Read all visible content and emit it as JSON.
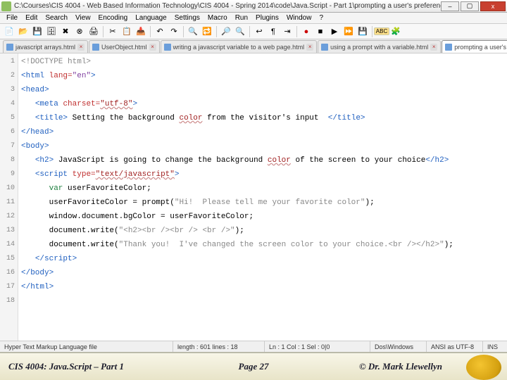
{
  "window": {
    "title": "C:\\Courses\\CIS 4004 - Web Based Information Technology\\CIS 4004 - Spring 2014\\code\\Java.Script - Part 1\\prompting a user's preference wi..."
  },
  "menu": [
    "File",
    "Edit",
    "Search",
    "View",
    "Encoding",
    "Language",
    "Settings",
    "Macro",
    "Run",
    "Plugins",
    "Window",
    "?"
  ],
  "tabs": [
    {
      "label": "javascript arrays.html",
      "active": false
    },
    {
      "label": "UserObject.html",
      "active": false
    },
    {
      "label": "writing a javascript variable to a web page.html",
      "active": false
    },
    {
      "label": "using a prompt with a variable.html",
      "active": false
    },
    {
      "label": "prompting a user's preference with a variable.htm",
      "active": true
    }
  ],
  "code": {
    "lines": [
      {
        "n": 1,
        "html": "<span class='c-gray'>&lt;!DOCTYPE html&gt;</span>"
      },
      {
        "n": 2,
        "html": "<span class='c-blue'>&lt;html</span> <span class='c-red'>lang=</span><span class='c-purple'>\"en\"</span><span class='c-blue'>&gt;</span>"
      },
      {
        "n": 3,
        "html": "<span class='c-blue'>&lt;head&gt;</span>"
      },
      {
        "n": 4,
        "html": "   <span class='c-blue'>&lt;meta</span> <span class='c-red'>charset=</span><span class='c-dred'>\"utf-8\"</span><span class='c-blue'>&gt;</span>"
      },
      {
        "n": 5,
        "html": "   <span class='c-blue'>&lt;title&gt;</span> Setting the background <span class='c-dred'>color</span> from the visitor's input  <span class='c-blue'>&lt;/title&gt;</span>"
      },
      {
        "n": 6,
        "html": "<span class='c-blue'>&lt;/head&gt;</span>"
      },
      {
        "n": 7,
        "html": "<span class='c-blue'>&lt;body&gt;</span>"
      },
      {
        "n": 8,
        "html": "   <span class='c-blue'>&lt;h2&gt;</span> JavaScript is going to change the background <span class='c-dred'>color</span> of the screen to your choice<span class='c-blue'>&lt;/h2&gt;</span>"
      },
      {
        "n": 9,
        "html": "   <span class='c-blue'>&lt;script</span> <span class='c-red'>type=</span><span class='c-dred'>\"text/javascript\"</span><span class='c-blue'>&gt;</span>"
      },
      {
        "n": 10,
        "html": "      <span class='c-green'>var</span> userFavoriteColor;"
      },
      {
        "n": 11,
        "html": "      userFavoriteColor = prompt(<span class='c-gray'>\"Hi!  Please tell me your favorite color\"</span>);"
      },
      {
        "n": 12,
        "html": "      window.document.bgColor = userFavoriteColor;"
      },
      {
        "n": 13,
        "html": "      document.write(<span class='c-gray'>\"&lt;h2&gt;&lt;br /&gt;&lt;br /&gt; &lt;br /&gt;\"</span>);"
      },
      {
        "n": 14,
        "html": "      document.write(<span class='c-gray'>\"Thank you!  I've changed the screen color to your choice.&lt;br /&gt;&lt;/h2&gt;\"</span>);"
      },
      {
        "n": 15,
        "html": "   <span class='c-blue'>&lt;/script&gt;</span>"
      },
      {
        "n": 16,
        "html": "<span class='c-blue'>&lt;/body&gt;</span>"
      },
      {
        "n": 17,
        "html": "<span class='c-blue'>&lt;/html&gt;</span>"
      },
      {
        "n": 18,
        "html": ""
      }
    ]
  },
  "status": {
    "filetype": "Hyper Text Markup Language file",
    "length": "length : 601   lines : 18",
    "pos": "Ln : 1   Col : 1   Sel : 0|0",
    "eol": "Dos\\Windows",
    "enc": "ANSI as UTF-8",
    "mode": "INS"
  },
  "footer": {
    "left": "CIS 4004: Java.Script – Part 1",
    "page": "Page 27",
    "right": "© Dr. Mark Llewellyn"
  }
}
